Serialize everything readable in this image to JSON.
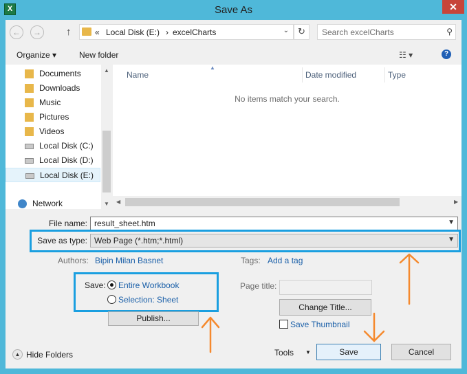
{
  "window": {
    "title": "Save As",
    "close_glyph": "✕",
    "app_icon": "excel-icon"
  },
  "nav": {
    "back_glyph": "←",
    "forward_glyph": "→",
    "up_glyph": "↑"
  },
  "address": {
    "prefix": "«",
    "segments": [
      "Local Disk (E:)",
      "excelCharts"
    ],
    "separator": "›",
    "dropdown_glyph": "⌄",
    "refresh_glyph": "↻"
  },
  "search": {
    "placeholder": "Search excelCharts",
    "icon": "search-icon",
    "glyph": "⚲"
  },
  "toolbar": {
    "organize_label": "Organize ▾",
    "new_folder_label": "New folder",
    "view_glyph": "☷ ▾",
    "help_glyph": "?"
  },
  "sidebar": {
    "items": [
      {
        "label": "Documents",
        "icon": "folder-icon"
      },
      {
        "label": "Downloads",
        "icon": "folder-icon"
      },
      {
        "label": "Music",
        "icon": "folder-icon"
      },
      {
        "label": "Pictures",
        "icon": "folder-icon"
      },
      {
        "label": "Videos",
        "icon": "folder-icon"
      },
      {
        "label": "Local Disk (C:)",
        "icon": "drive-icon"
      },
      {
        "label": "Local Disk (D:)",
        "icon": "drive-icon"
      },
      {
        "label": "Local Disk (E:)",
        "icon": "drive-icon",
        "selected": true
      },
      {
        "label": "Network",
        "icon": "network-icon"
      }
    ]
  },
  "filelist": {
    "columns": [
      "Name",
      "Date modified",
      "Type"
    ],
    "empty_message": "No items match your search."
  },
  "form": {
    "filename_label": "File name:",
    "filename_value": "result_sheet.htm",
    "savetype_label": "Save as type:",
    "savetype_value": "Web Page (*.htm;*.html)",
    "authors_label": "Authors:",
    "authors_value": "Bipin Milan Basnet",
    "tags_label": "Tags:",
    "tags_value": "Add a tag",
    "save_scope_label": "Save:",
    "save_scope_options": [
      "Entire Workbook",
      "Selection: Sheet"
    ],
    "page_title_label": "Page title:",
    "change_title_label": "Change Title...",
    "publish_label": "Publish...",
    "save_thumbnail_label": "Save Thumbnail"
  },
  "footer": {
    "hide_folders_label": "Hide Folders",
    "tools_label": "Tools",
    "tools_glyph": "▼",
    "save_label": "Save",
    "cancel_label": "Cancel",
    "hide_glyph": "▲"
  },
  "colors": {
    "titlebar": "#4fb8d9",
    "highlight": "#1a9fe0",
    "annotation_arrow": "#f5892d",
    "link": "#1a5fa8"
  }
}
